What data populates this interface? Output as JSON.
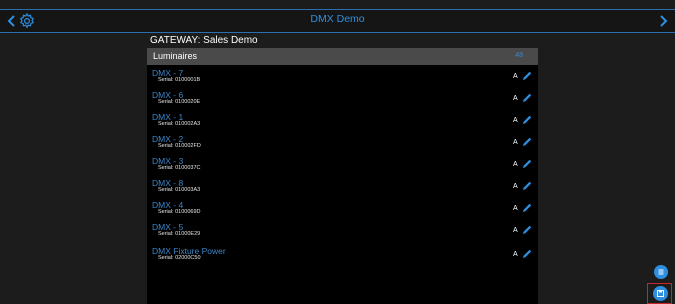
{
  "header": {
    "title": "DMX Demo",
    "back_icon": "chevron-left-icon",
    "settings_icon": "gear-icon",
    "forward_icon": "chevron-right-icon"
  },
  "gateway": {
    "label": "GATEWAY: Sales Demo"
  },
  "luminaires": {
    "title": "Luminaires",
    "count": "48",
    "items": [
      {
        "name": "DMX - 7",
        "serial": "Serial: 0100001B",
        "mode": "A"
      },
      {
        "name": "DMX - 6",
        "serial": "Serial: 0100020E",
        "mode": "A"
      },
      {
        "name": "DMX - 1",
        "serial": "Serial: 010002A3",
        "mode": "A"
      },
      {
        "name": "DMX - 2",
        "serial": "Serial: 010002FD",
        "mode": "A"
      },
      {
        "name": "DMX - 3",
        "serial": "Serial: 0100037C",
        "mode": "A"
      },
      {
        "name": "DMX - 8",
        "serial": "Serial: 010003A3",
        "mode": "A"
      },
      {
        "name": "DMX - 4",
        "serial": "Serial: 0100069D",
        "mode": "A"
      },
      {
        "name": "DMX - 5",
        "serial": "Serial: 01000E29",
        "mode": "A"
      },
      {
        "name": "DMX Fixture Power",
        "serial": "Serial: 02000C50",
        "mode": "A"
      }
    ]
  },
  "colors": {
    "accent": "#2e8fe0",
    "background": "#1c1c1c",
    "panel": "#000000",
    "header_bar": "#4a4a4a",
    "highlight": "#c1272d"
  },
  "fab": {
    "small_icon": "list-icon",
    "main_icon": "save-icon"
  }
}
